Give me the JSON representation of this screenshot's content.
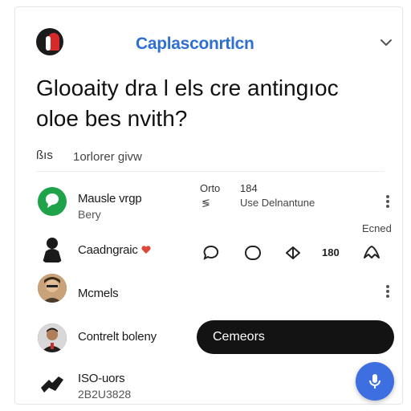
{
  "header": {
    "app_title": "Caplasconrtlcn",
    "logo_icon": "brand-logo-icon",
    "dropdown_icon": "chevron-down-icon"
  },
  "question": {
    "line1": "Glooaity dra l els cre antingıoc",
    "line2": "oloe bes nvith?"
  },
  "meta": {
    "icon_text": "ßıs",
    "label": "1orlorer givw"
  },
  "rows": [
    {
      "name": "Mausle vrgp",
      "sub": "Bery",
      "stat_top_a": "Orto",
      "stat_top_b": "184",
      "stat_bottom_icon": "≶",
      "stat_bottom_text": "Use Delnantune",
      "tag": "Ecned",
      "avatar_color": "#1fa34a"
    },
    {
      "name": "Caadngraic",
      "count": "180",
      "heart_color": "#e0473a"
    },
    {
      "name": "Mcmels"
    },
    {
      "name": "Contrelt boleny",
      "action_label": "Cemeors"
    },
    {
      "name": "ISO-uors",
      "sub": "2B2U3828"
    }
  ],
  "colors": {
    "accent": "#2f6fd1",
    "fab": "#3d6fe0",
    "dark_button": "#131313"
  }
}
